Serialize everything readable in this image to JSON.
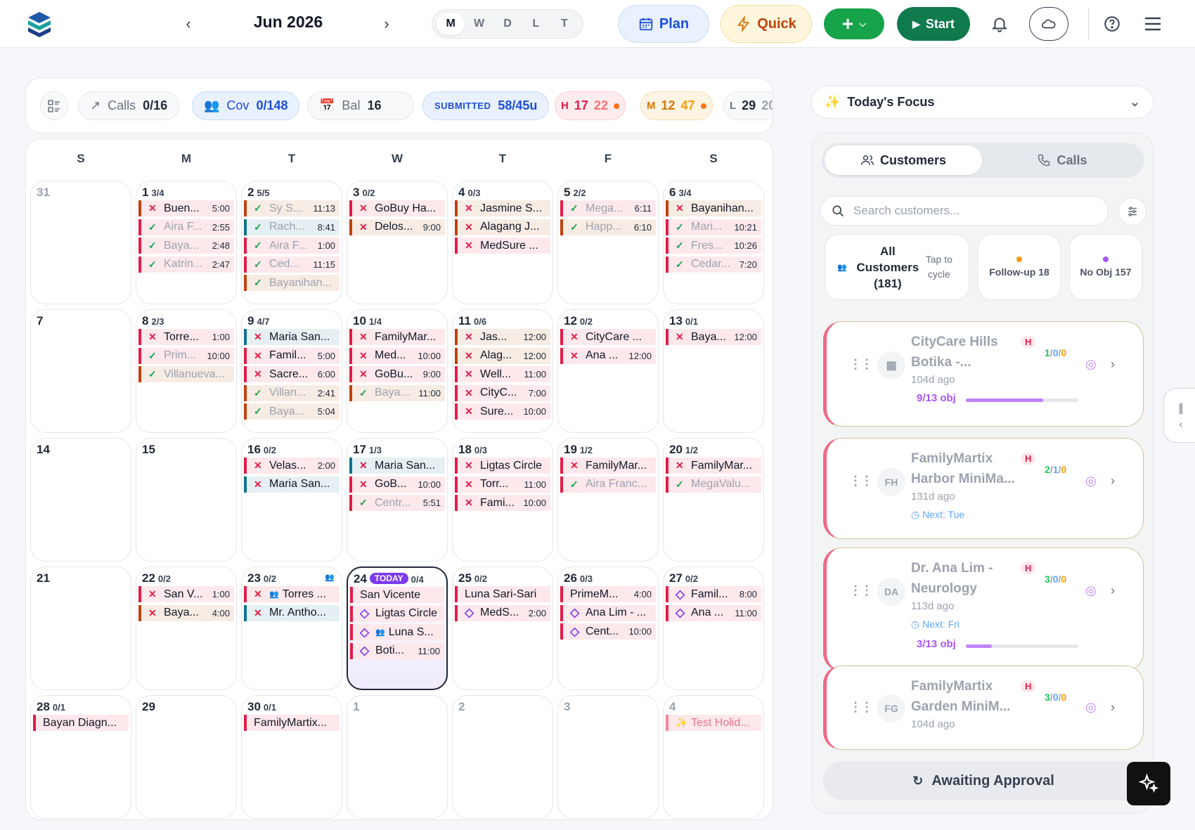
{
  "header": {
    "month": "Jun 2026",
    "views": [
      "M",
      "W",
      "D",
      "L",
      "T"
    ],
    "active_view": "M",
    "plan": "Plan",
    "quick": "Quick",
    "start": "Start"
  },
  "stats": {
    "calls_label": "Calls",
    "calls_value": "0/16",
    "cov_label": "Cov",
    "cov_value": "0/148",
    "bal_label": "Bal",
    "bal_value": "16",
    "submitted_label": "SUBMITTED",
    "submitted_value": "58/45u",
    "h_label": "H",
    "h_a": "17",
    "h_b": "22",
    "m_label": "M",
    "m_a": "12",
    "m_b": "47",
    "l_label": "L",
    "l_a": "29",
    "l_b": "20"
  },
  "calendar": {
    "weekdays": [
      "S",
      "M",
      "T",
      "W",
      "T",
      "F",
      "S"
    ],
    "today_label": "TODAY",
    "days": [
      {
        "d": "31",
        "muted": true,
        "events": []
      },
      {
        "d": "1",
        "c": "3/4",
        "events": [
          {
            "i": "x",
            "t": "Buen...",
            "tm": "5:00",
            "b": "#c2410c",
            "bg": "#fde8ec"
          },
          {
            "i": "v",
            "t": "Aira F...",
            "tm": "2:55",
            "b": "#e11d48",
            "bg": "#fde8ec"
          },
          {
            "i": "v",
            "t": "Baya...",
            "tm": "2:48",
            "b": "#e11d48",
            "bg": "#fde8ec"
          },
          {
            "i": "v",
            "t": "Katrin...",
            "tm": "2:47",
            "b": "#e11d48",
            "bg": "#fde8ec"
          }
        ]
      },
      {
        "d": "2",
        "c": "5/5",
        "events": [
          {
            "i": "v",
            "t": "Sy S...",
            "tm": "11:13",
            "b": "#c2410c",
            "bg": "#f7ece4"
          },
          {
            "i": "v",
            "t": "Rach...",
            "tm": "8:41",
            "b": "#0e7490",
            "bg": "#e6f0f3"
          },
          {
            "i": "v",
            "t": "Aira F...",
            "tm": "1:00",
            "b": "#e11d48",
            "bg": "#fde8ec"
          },
          {
            "i": "v",
            "t": "Ced...",
            "tm": "11:15",
            "b": "#e11d48",
            "bg": "#fde8ec"
          },
          {
            "i": "v",
            "t": "Bayanihan...",
            "tm": "",
            "b": "#c2410c",
            "bg": "#f7ece4"
          }
        ]
      },
      {
        "d": "3",
        "c": "0/2",
        "events": [
          {
            "i": "x",
            "t": "GoBuy Ha...",
            "tm": "",
            "b": "#e11d48",
            "bg": "#fde8ec"
          },
          {
            "i": "x",
            "t": "Delos...",
            "tm": "9:00",
            "b": "#c2410c",
            "bg": "#f7ece4"
          }
        ]
      },
      {
        "d": "4",
        "c": "0/3",
        "events": [
          {
            "i": "x",
            "t": "Jasmine S...",
            "tm": "",
            "b": "#c2410c",
            "bg": "#f7ece4"
          },
          {
            "i": "x",
            "t": "Alagang J...",
            "tm": "",
            "b": "#c2410c",
            "bg": "#f7ece4"
          },
          {
            "i": "x",
            "t": "MedSure ...",
            "tm": "",
            "b": "#e11d48",
            "bg": "#fde8ec"
          }
        ]
      },
      {
        "d": "5",
        "c": "2/2",
        "events": [
          {
            "i": "v",
            "t": "Mega...",
            "tm": "6:11",
            "b": "#e11d48",
            "bg": "#fde8ec"
          },
          {
            "i": "v",
            "t": "Happ...",
            "tm": "6:10",
            "b": "#c2410c",
            "bg": "#f7ece4"
          }
        ]
      },
      {
        "d": "6",
        "c": "3/4",
        "events": [
          {
            "i": "x",
            "t": "Bayanihan...",
            "tm": "",
            "b": "#c2410c",
            "bg": "#f7ece4"
          },
          {
            "i": "v",
            "t": "Mari...",
            "tm": "10:21",
            "b": "#e11d48",
            "bg": "#fde8ec"
          },
          {
            "i": "v",
            "t": "Fres...",
            "tm": "10:26",
            "b": "#e11d48",
            "bg": "#fde8ec"
          },
          {
            "i": "v",
            "t": "Cedar...",
            "tm": "7:20",
            "b": "#e11d48",
            "bg": "#fde8ec"
          }
        ]
      },
      {
        "d": "7",
        "events": []
      },
      {
        "d": "8",
        "c": "2/3",
        "events": [
          {
            "i": "x",
            "t": "Torre...",
            "tm": "1:00",
            "b": "#e11d48",
            "bg": "#fde8ec"
          },
          {
            "i": "v",
            "t": "Prim...",
            "tm": "10:00",
            "b": "#e11d48",
            "bg": "#fde8ec"
          },
          {
            "i": "v",
            "t": "Villanueva...",
            "tm": "",
            "b": "#c2410c",
            "bg": "#f7ece4"
          }
        ]
      },
      {
        "d": "9",
        "c": "4/7",
        "events": [
          {
            "i": "x",
            "t": "Maria San...",
            "tm": "",
            "b": "#0e7490",
            "bg": "#e6f0f3"
          },
          {
            "i": "x",
            "t": "Famil...",
            "tm": "5:00",
            "b": "#e11d48",
            "bg": "#fde8ec"
          },
          {
            "i": "x",
            "t": "Sacre...",
            "tm": "6:00",
            "b": "#e11d48",
            "bg": "#fde8ec"
          },
          {
            "i": "v",
            "t": "Villan...",
            "tm": "2:41",
            "b": "#c2410c",
            "bg": "#f7ece4"
          },
          {
            "i": "v",
            "t": "Baya...",
            "tm": "5:04",
            "b": "#c2410c",
            "bg": "#f7ece4"
          }
        ]
      },
      {
        "d": "10",
        "c": "1/4",
        "events": [
          {
            "i": "x",
            "t": "FamilyMar...",
            "tm": "",
            "b": "#e11d48",
            "bg": "#fde8ec"
          },
          {
            "i": "x",
            "t": "Med...",
            "tm": "10:00",
            "b": "#e11d48",
            "bg": "#fde8ec"
          },
          {
            "i": "x",
            "t": "GoBu...",
            "tm": "9:00",
            "b": "#e11d48",
            "bg": "#fde8ec"
          },
          {
            "i": "v",
            "t": "Baya...",
            "tm": "11:00",
            "b": "#c2410c",
            "bg": "#f7ece4"
          }
        ]
      },
      {
        "d": "11",
        "c": "0/6",
        "events": [
          {
            "i": "x",
            "t": "Jas...",
            "tm": "12:00",
            "b": "#c2410c",
            "bg": "#f7ece4"
          },
          {
            "i": "x",
            "t": "Alag...",
            "tm": "12:00",
            "b": "#c2410c",
            "bg": "#f7ece4"
          },
          {
            "i": "x",
            "t": "Well...",
            "tm": "11:00",
            "b": "#e11d48",
            "bg": "#fde8ec"
          },
          {
            "i": "x",
            "t": "CityC...",
            "tm": "7:00",
            "b": "#e11d48",
            "bg": "#fde8ec"
          },
          {
            "i": "x",
            "t": "Sure...",
            "tm": "10:00",
            "b": "#e11d48",
            "bg": "#fde8ec"
          }
        ]
      },
      {
        "d": "12",
        "c": "0/2",
        "events": [
          {
            "i": "x",
            "t": "CityCare ...",
            "tm": "",
            "b": "#e11d48",
            "bg": "#fde8ec"
          },
          {
            "i": "x",
            "t": "Ana ...",
            "tm": "12:00",
            "b": "#e11d48",
            "bg": "#fde8ec"
          }
        ]
      },
      {
        "d": "13",
        "c": "0/1",
        "events": [
          {
            "i": "x",
            "t": "Baya...",
            "tm": "12:00",
            "b": "#e11d48",
            "bg": "#fde8ec"
          }
        ]
      },
      {
        "d": "14",
        "events": []
      },
      {
        "d": "15",
        "events": []
      },
      {
        "d": "16",
        "c": "0/2",
        "events": [
          {
            "i": "x",
            "t": "Velas...",
            "tm": "2:00",
            "b": "#e11d48",
            "bg": "#fde8ec"
          },
          {
            "i": "x",
            "t": "Maria San...",
            "tm": "",
            "b": "#0e7490",
            "bg": "#e6f0f3"
          }
        ]
      },
      {
        "d": "17",
        "c": "1/3",
        "events": [
          {
            "i": "x",
            "t": "Maria San...",
            "tm": "",
            "b": "#0e7490",
            "bg": "#e6f0f3"
          },
          {
            "i": "x",
            "t": "GoB...",
            "tm": "10:00",
            "b": "#e11d48",
            "bg": "#fde8ec"
          },
          {
            "i": "v",
            "t": "Centr...",
            "tm": "5:51",
            "b": "#e11d48",
            "bg": "#fde8ec"
          }
        ]
      },
      {
        "d": "18",
        "c": "0/3",
        "events": [
          {
            "i": "x",
            "t": "Ligtas Circle",
            "tm": "",
            "b": "#e11d48",
            "bg": "#fde8ec"
          },
          {
            "i": "x",
            "t": "Torr...",
            "tm": "11:00",
            "b": "#e11d48",
            "bg": "#fde8ec"
          },
          {
            "i": "x",
            "t": "Fami...",
            "tm": "10:00",
            "b": "#e11d48",
            "bg": "#fde8ec"
          }
        ]
      },
      {
        "d": "19",
        "c": "1/2",
        "events": [
          {
            "i": "x",
            "t": "FamilyMar...",
            "tm": "",
            "b": "#e11d48",
            "bg": "#fde8ec"
          },
          {
            "i": "v",
            "t": "Aira Franc...",
            "tm": "",
            "b": "#e11d48",
            "bg": "#fde8ec"
          }
        ]
      },
      {
        "d": "20",
        "c": "1/2",
        "events": [
          {
            "i": "x",
            "t": "FamilyMar...",
            "tm": "",
            "b": "#e11d48",
            "bg": "#fde8ec"
          },
          {
            "i": "v",
            "t": "MegaValu...",
            "tm": "",
            "b": "#e11d48",
            "bg": "#fde8ec"
          }
        ]
      },
      {
        "d": "21",
        "events": []
      },
      {
        "d": "22",
        "c": "0/2",
        "events": [
          {
            "i": "x",
            "t": "San V...",
            "tm": "1:00",
            "b": "#e11d48",
            "bg": "#fde8ec"
          },
          {
            "i": "x",
            "t": "Baya...",
            "tm": "4:00",
            "b": "#c2410c",
            "bg": "#f7ece4"
          }
        ]
      },
      {
        "d": "23",
        "c": "0/2",
        "people": true,
        "events": [
          {
            "i": "x",
            "p": true,
            "t": "Torres ...",
            "tm": "",
            "b": "#e11d48",
            "bg": "#fde8ec"
          },
          {
            "i": "x",
            "t": "Mr. Antho...",
            "tm": "",
            "b": "#0e7490",
            "bg": "#e6f0f3"
          }
        ]
      },
      {
        "d": "24",
        "c": "0/4",
        "today": true,
        "events": [
          {
            "i": "",
            "t": "San Vicente",
            "tm": "",
            "b": "#e11d48",
            "bg": "#fde8ec"
          },
          {
            "i": "d",
            "t": "Ligtas Circle",
            "tm": "",
            "b": "#e11d48",
            "bg": "#fde8ec"
          },
          {
            "i": "d",
            "p": true,
            "t": "Luna S...",
            "tm": "",
            "b": "#e11d48",
            "bg": "#fde8ec"
          },
          {
            "i": "d",
            "t": "Boti...",
            "tm": "11:00",
            "b": "#e11d48",
            "bg": "#fde8ec"
          }
        ]
      },
      {
        "d": "25",
        "c": "0/2",
        "events": [
          {
            "i": "",
            "t": "Luna Sari-Sari",
            "tm": "",
            "b": "#e11d48",
            "bg": "#fde8ec"
          },
          {
            "i": "d",
            "t": "MedS...",
            "tm": "2:00",
            "b": "#e11d48",
            "bg": "#fde8ec"
          }
        ]
      },
      {
        "d": "26",
        "c": "0/3",
        "events": [
          {
            "i": "",
            "t": "PrimeM...",
            "tm": "4:00",
            "b": "#e11d48",
            "bg": "#fde8ec"
          },
          {
            "i": "d",
            "t": "Ana Lim - ...",
            "tm": "",
            "b": "#e11d48",
            "bg": "#fde8ec"
          },
          {
            "i": "d",
            "t": "Cent...",
            "tm": "10:00",
            "b": "#e11d48",
            "bg": "#fde8ec"
          }
        ]
      },
      {
        "d": "27",
        "c": "0/2",
        "events": [
          {
            "i": "d",
            "t": "Famil...",
            "tm": "8:00",
            "b": "#e11d48",
            "bg": "#fde8ec"
          },
          {
            "i": "d",
            "t": "Ana ...",
            "tm": "11:00",
            "b": "#e11d48",
            "bg": "#fde8ec"
          }
        ]
      },
      {
        "d": "28",
        "c": "0/1",
        "events": [
          {
            "i": "",
            "t": "Bayan Diagn...",
            "tm": "",
            "b": "#e11d48",
            "bg": "#fde8ec"
          }
        ]
      },
      {
        "d": "29",
        "events": []
      },
      {
        "d": "30",
        "c": "0/1",
        "events": [
          {
            "i": "",
            "t": "FamilyMartix...",
            "tm": "",
            "b": "#e11d48",
            "bg": "#fde8ec"
          }
        ]
      },
      {
        "d": "1",
        "muted": true,
        "events": []
      },
      {
        "d": "2",
        "muted": true,
        "events": []
      },
      {
        "d": "3",
        "muted": true,
        "events": []
      },
      {
        "d": "4",
        "muted": true,
        "events": [
          {
            "i": "h",
            "t": "Test Holid...",
            "tm": "",
            "b": "#f0889f",
            "bg": "#fde8ec",
            "holiday": true
          }
        ]
      }
    ]
  },
  "panel": {
    "focus_title": "Today's Focus",
    "tab_customers": "Customers",
    "tab_calls": "Calls",
    "search_placeholder": "Search customers...",
    "all_label": "All Customers (181)",
    "all_hint": "Tap to cycle",
    "followup": "Follow-up 18",
    "noobj": "No Obj 157",
    "awaiting": "Awaiting Approval",
    "customers": [
      {
        "name": "CityCare Hills Botika -...",
        "initials": "",
        "h": "H",
        "r1": "1",
        "r2": "0",
        "r3": "0",
        "ago": "104d ago",
        "next": "",
        "obj": "9/13 obj",
        "progress": 0.69
      },
      {
        "name": "FamilyMartix Harbor MiniMa...",
        "initials": "FH",
        "h": "H",
        "r1": "2",
        "r2": "1",
        "r3": "0",
        "ago": "131d ago",
        "next": "Next: Tue",
        "obj": "",
        "progress": null
      },
      {
        "name": "Dr. Ana Lim - Neurology",
        "initials": "DA",
        "h": "H",
        "r1": "3",
        "r2": "0",
        "r3": "0",
        "ago": "113d ago",
        "next": "Next: Fri",
        "obj": "3/13 obj",
        "progress": 0.23
      },
      {
        "name": "FamilyMartix Garden MiniM...",
        "initials": "FG",
        "h": "H",
        "r1": "3",
        "r2": "0",
        "r3": "0",
        "ago": "104d ago",
        "next": "",
        "obj": "",
        "progress": null
      }
    ]
  }
}
